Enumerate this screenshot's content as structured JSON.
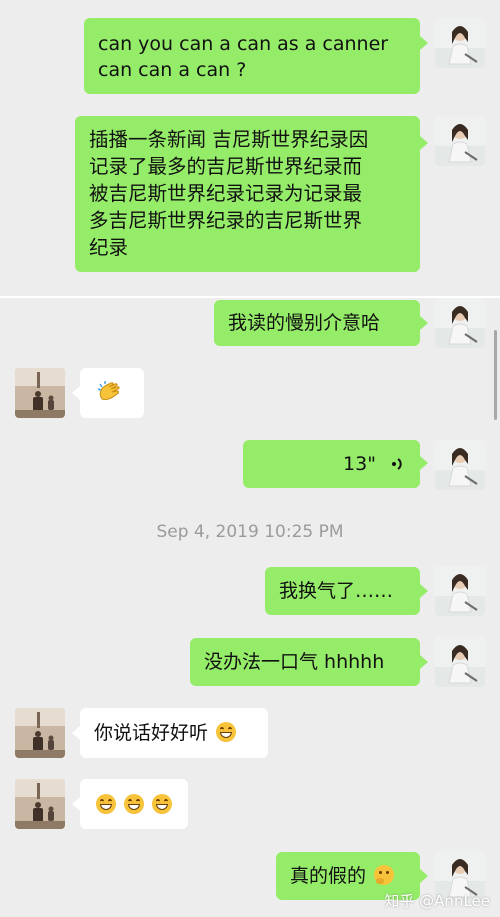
{
  "colors": {
    "bubble_me": "#95ec69",
    "bubble_them": "#ffffff",
    "background": "#ededed",
    "timestamp": "#9b9b9b"
  },
  "messages": [
    {
      "side": "me",
      "line1": "can you can a can as a canner",
      "line2": "can can a can ?"
    },
    {
      "side": "me",
      "lines": [
        "插播一条新闻 吉尼斯世界纪录因",
        "记录了最多的吉尼斯世界纪录而",
        "被吉尼斯世界纪录记录为记录最",
        "多吉尼斯世界纪录的吉尼斯世界",
        "纪录"
      ]
    },
    {
      "side": "me",
      "text": "我读的慢别介意哈"
    },
    {
      "side": "them",
      "emoji": "clapping-hands-icon"
    },
    {
      "side": "me",
      "voice_duration": "13\"",
      "icon": "voice-wave-icon"
    },
    {
      "side": "me",
      "text": "我换气了……"
    },
    {
      "side": "me",
      "text": "没办法一口气 hhhhh"
    },
    {
      "side": "them",
      "text": "你说话好好听",
      "emoji": "grinning-face-icon"
    },
    {
      "side": "them",
      "emoji": "grinning-face-icon x3"
    },
    {
      "side": "me",
      "text": "真的假的",
      "emoji": "thinking-face-icon"
    }
  ],
  "timestamp": "Sep 4, 2019 10:25 PM",
  "watermark": "知乎 @AnnLee"
}
